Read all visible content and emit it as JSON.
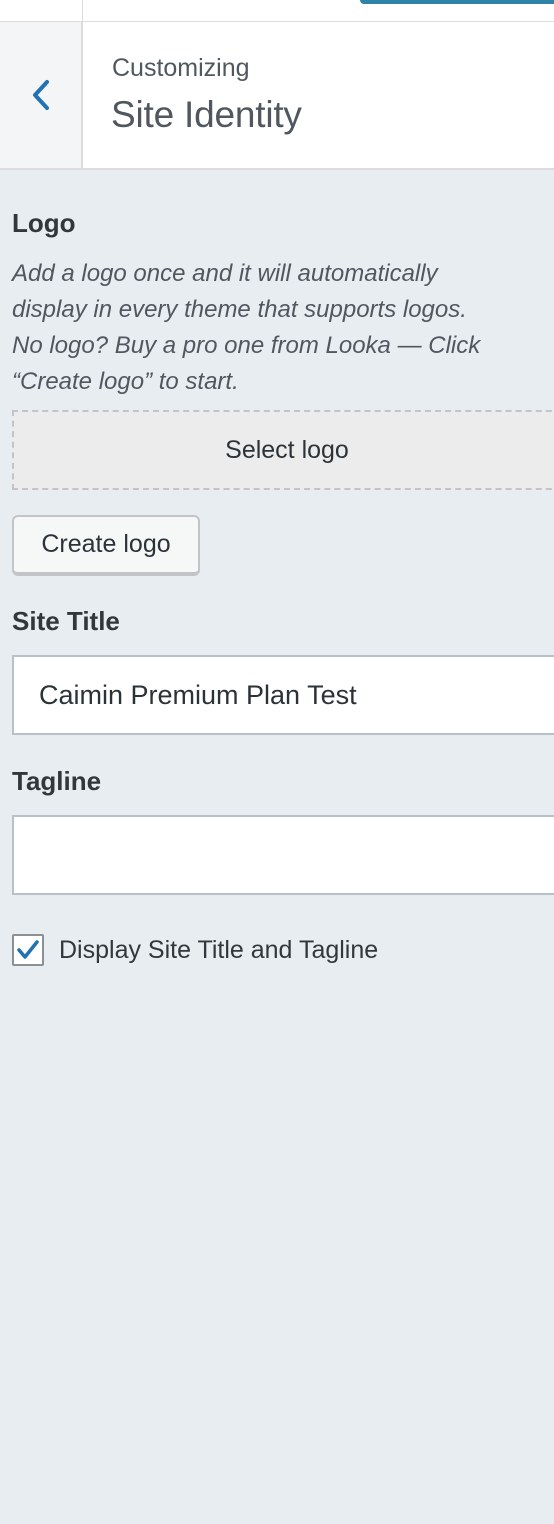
{
  "header": {
    "breadcrumb": "Customizing",
    "title": "Site Identity",
    "back_icon": "chevron-left-icon"
  },
  "logo": {
    "label": "Logo",
    "description_lines": [
      "Add a logo once and it will automatically",
      "display in every theme that supports logos.",
      "No logo? Buy a pro one from Looka — Click",
      "“Create logo” to start."
    ],
    "select_button": "Select logo",
    "create_button": "Create logo"
  },
  "site_title": {
    "label": "Site Title",
    "value": "Caimin Premium Plan Test"
  },
  "tagline": {
    "label": "Tagline",
    "value": ""
  },
  "display_option": {
    "label": "Display Site Title and Tagline",
    "checked": true
  },
  "colors": {
    "accent": "#2271b1",
    "panel_bg": "#e8edf2"
  }
}
